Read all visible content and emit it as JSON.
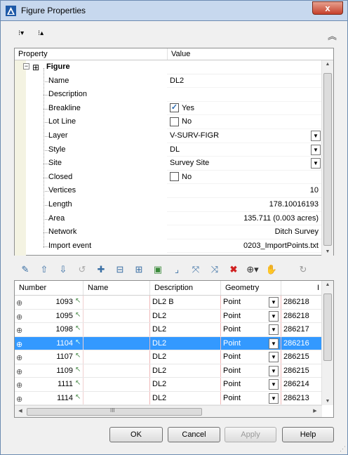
{
  "window": {
    "title": "Figure Properties",
    "close_label": "x"
  },
  "properties": {
    "col_property": "Property",
    "col_value": "Value",
    "group": "Figure",
    "rows": [
      {
        "name": "Name",
        "value": "DL2",
        "kind": "text"
      },
      {
        "name": "Description",
        "value": "",
        "kind": "text"
      },
      {
        "name": "Breakline",
        "value": "Yes",
        "kind": "check",
        "checked": true
      },
      {
        "name": "Lot Line",
        "value": "No",
        "kind": "check",
        "checked": false
      },
      {
        "name": "Layer",
        "value": "V-SURV-FIGR",
        "kind": "dropdown"
      },
      {
        "name": "Style",
        "value": "DL",
        "kind": "dropdown"
      },
      {
        "name": "Site",
        "value": "Survey Site",
        "kind": "dropdown"
      },
      {
        "name": "Closed",
        "value": "No",
        "kind": "check",
        "checked": false
      },
      {
        "name": "Vertices",
        "value": "10",
        "kind": "readonly"
      },
      {
        "name": "Length",
        "value": "178.10016193",
        "kind": "readonly"
      },
      {
        "name": "Area",
        "value": "135.711 (0.003 acres)",
        "kind": "readonly"
      },
      {
        "name": "Network",
        "value": "Ditch Survey",
        "kind": "readonly"
      },
      {
        "name": "Import event",
        "value": "0203_ImportPoints.txt",
        "kind": "readonly"
      }
    ]
  },
  "points_grid": {
    "columns": [
      "Number",
      "Name",
      "Description",
      "Geometry",
      "I"
    ],
    "rows": [
      {
        "number": "1093",
        "name": "",
        "description": "DL2 B",
        "geometry": "Point",
        "value": "286218",
        "selected": false
      },
      {
        "number": "1095",
        "name": "",
        "description": "DL2",
        "geometry": "Point",
        "value": "286218",
        "selected": false
      },
      {
        "number": "1098",
        "name": "",
        "description": "DL2",
        "geometry": "Point",
        "value": "286217",
        "selected": false
      },
      {
        "number": "1104",
        "name": "",
        "description": "DL2",
        "geometry": "Point",
        "value": "286216",
        "selected": true
      },
      {
        "number": "1107",
        "name": "",
        "description": "DL2",
        "geometry": "Point",
        "value": "286215",
        "selected": false
      },
      {
        "number": "1109",
        "name": "",
        "description": "DL2",
        "geometry": "Point",
        "value": "286215",
        "selected": false
      },
      {
        "number": "1111",
        "name": "",
        "description": "DL2",
        "geometry": "Point",
        "value": "286214",
        "selected": false
      },
      {
        "number": "1114",
        "name": "",
        "description": "DL2",
        "geometry": "Point",
        "value": "286213",
        "selected": false
      }
    ],
    "hscroll_thumb_label": "III"
  },
  "buttons": {
    "ok": "OK",
    "cancel": "Cancel",
    "apply": "Apply",
    "help": "Help"
  }
}
